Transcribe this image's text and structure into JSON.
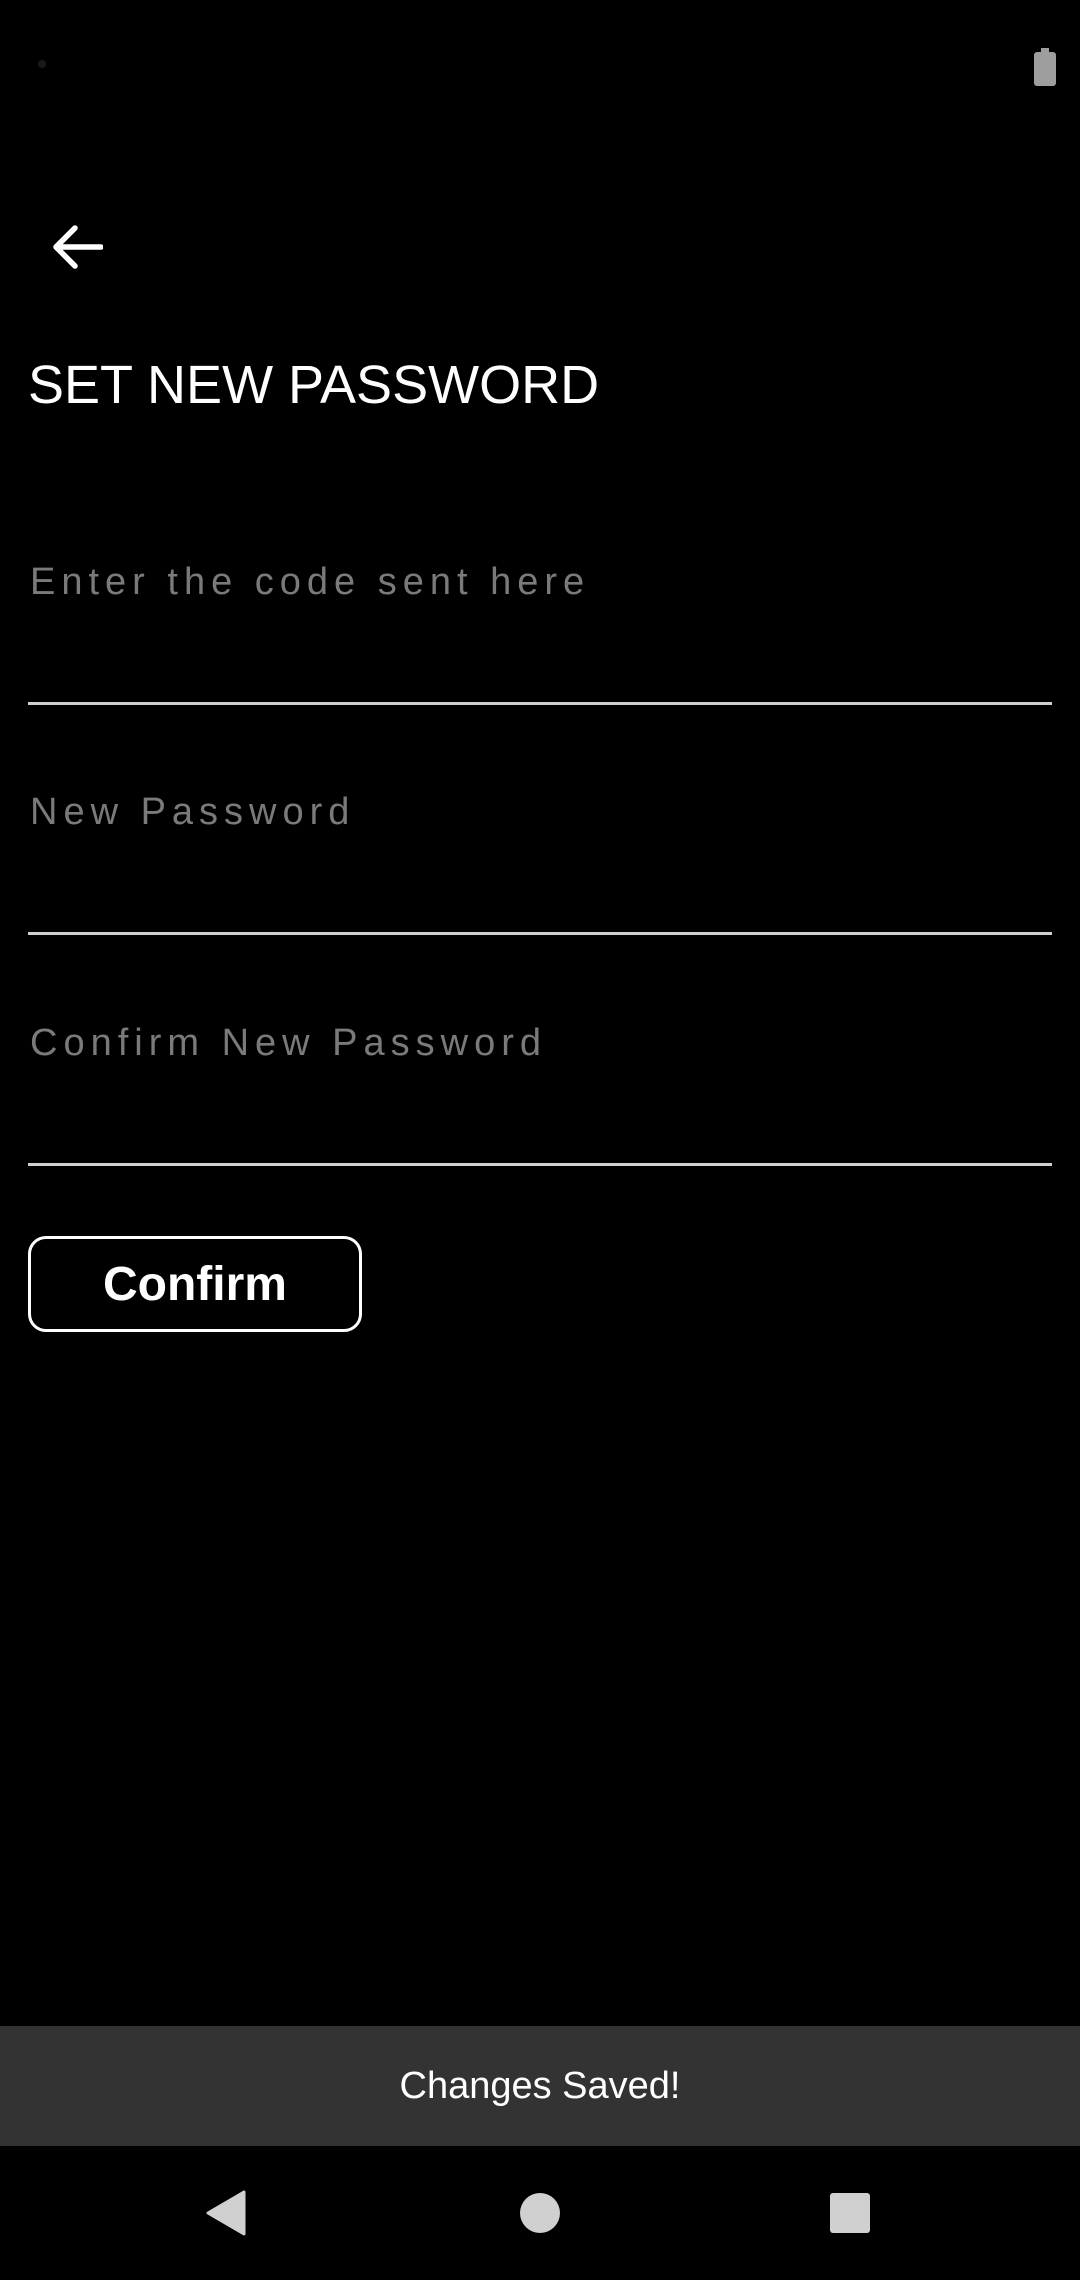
{
  "header": {
    "title": "SET NEW PASSWORD"
  },
  "form": {
    "code_placeholder": "Enter the code sent here",
    "new_password_placeholder": "New Password",
    "confirm_password_placeholder": "Confirm New Password",
    "confirm_label": "Confirm"
  },
  "snackbar": {
    "message": "Changes Saved!"
  },
  "icons": {
    "back": "arrow-left-icon",
    "battery": "battery-icon",
    "nav_back": "triangle-back-icon",
    "nav_home": "circle-home-icon",
    "nav_recents": "square-recents-icon"
  },
  "colors": {
    "background": "#000000",
    "snackbar_bg": "#333333",
    "placeholder": "#7a7a7a",
    "underline": "#cfcfcf"
  }
}
